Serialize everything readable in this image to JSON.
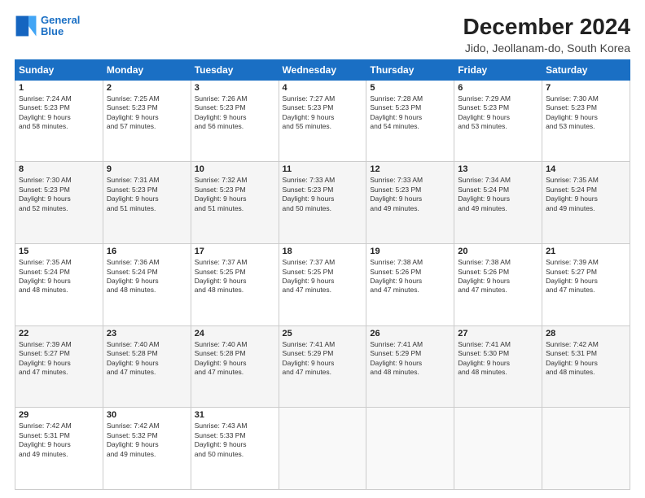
{
  "logo": {
    "line1": "General",
    "line2": "Blue"
  },
  "title": "December 2024",
  "subtitle": "Jido, Jeollanam-do, South Korea",
  "days_of_week": [
    "Sunday",
    "Monday",
    "Tuesday",
    "Wednesday",
    "Thursday",
    "Friday",
    "Saturday"
  ],
  "weeks": [
    [
      {
        "day": "1",
        "sunrise": "7:24 AM",
        "sunset": "5:23 PM",
        "daylight": "9 hours and 58 minutes."
      },
      {
        "day": "2",
        "sunrise": "7:25 AM",
        "sunset": "5:23 PM",
        "daylight": "9 hours and 57 minutes."
      },
      {
        "day": "3",
        "sunrise": "7:26 AM",
        "sunset": "5:23 PM",
        "daylight": "9 hours and 56 minutes."
      },
      {
        "day": "4",
        "sunrise": "7:27 AM",
        "sunset": "5:23 PM",
        "daylight": "9 hours and 55 minutes."
      },
      {
        "day": "5",
        "sunrise": "7:28 AM",
        "sunset": "5:23 PM",
        "daylight": "9 hours and 54 minutes."
      },
      {
        "day": "6",
        "sunrise": "7:29 AM",
        "sunset": "5:23 PM",
        "daylight": "9 hours and 53 minutes."
      },
      {
        "day": "7",
        "sunrise": "7:30 AM",
        "sunset": "5:23 PM",
        "daylight": "9 hours and 53 minutes."
      }
    ],
    [
      {
        "day": "8",
        "sunrise": "7:30 AM",
        "sunset": "5:23 PM",
        "daylight": "9 hours and 52 minutes."
      },
      {
        "day": "9",
        "sunrise": "7:31 AM",
        "sunset": "5:23 PM",
        "daylight": "9 hours and 51 minutes."
      },
      {
        "day": "10",
        "sunrise": "7:32 AM",
        "sunset": "5:23 PM",
        "daylight": "9 hours and 51 minutes."
      },
      {
        "day": "11",
        "sunrise": "7:33 AM",
        "sunset": "5:23 PM",
        "daylight": "9 hours and 50 minutes."
      },
      {
        "day": "12",
        "sunrise": "7:33 AM",
        "sunset": "5:23 PM",
        "daylight": "9 hours and 49 minutes."
      },
      {
        "day": "13",
        "sunrise": "7:34 AM",
        "sunset": "5:24 PM",
        "daylight": "9 hours and 49 minutes."
      },
      {
        "day": "14",
        "sunrise": "7:35 AM",
        "sunset": "5:24 PM",
        "daylight": "9 hours and 49 minutes."
      }
    ],
    [
      {
        "day": "15",
        "sunrise": "7:35 AM",
        "sunset": "5:24 PM",
        "daylight": "9 hours and 48 minutes."
      },
      {
        "day": "16",
        "sunrise": "7:36 AM",
        "sunset": "5:24 PM",
        "daylight": "9 hours and 48 minutes."
      },
      {
        "day": "17",
        "sunrise": "7:37 AM",
        "sunset": "5:25 PM",
        "daylight": "9 hours and 48 minutes."
      },
      {
        "day": "18",
        "sunrise": "7:37 AM",
        "sunset": "5:25 PM",
        "daylight": "9 hours and 47 minutes."
      },
      {
        "day": "19",
        "sunrise": "7:38 AM",
        "sunset": "5:26 PM",
        "daylight": "9 hours and 47 minutes."
      },
      {
        "day": "20",
        "sunrise": "7:38 AM",
        "sunset": "5:26 PM",
        "daylight": "9 hours and 47 minutes."
      },
      {
        "day": "21",
        "sunrise": "7:39 AM",
        "sunset": "5:27 PM",
        "daylight": "9 hours and 47 minutes."
      }
    ],
    [
      {
        "day": "22",
        "sunrise": "7:39 AM",
        "sunset": "5:27 PM",
        "daylight": "9 hours and 47 minutes."
      },
      {
        "day": "23",
        "sunrise": "7:40 AM",
        "sunset": "5:28 PM",
        "daylight": "9 hours and 47 minutes."
      },
      {
        "day": "24",
        "sunrise": "7:40 AM",
        "sunset": "5:28 PM",
        "daylight": "9 hours and 47 minutes."
      },
      {
        "day": "25",
        "sunrise": "7:41 AM",
        "sunset": "5:29 PM",
        "daylight": "9 hours and 47 minutes."
      },
      {
        "day": "26",
        "sunrise": "7:41 AM",
        "sunset": "5:29 PM",
        "daylight": "9 hours and 48 minutes."
      },
      {
        "day": "27",
        "sunrise": "7:41 AM",
        "sunset": "5:30 PM",
        "daylight": "9 hours and 48 minutes."
      },
      {
        "day": "28",
        "sunrise": "7:42 AM",
        "sunset": "5:31 PM",
        "daylight": "9 hours and 48 minutes."
      }
    ],
    [
      {
        "day": "29",
        "sunrise": "7:42 AM",
        "sunset": "5:31 PM",
        "daylight": "9 hours and 49 minutes."
      },
      {
        "day": "30",
        "sunrise": "7:42 AM",
        "sunset": "5:32 PM",
        "daylight": "9 hours and 49 minutes."
      },
      {
        "day": "31",
        "sunrise": "7:43 AM",
        "sunset": "5:33 PM",
        "daylight": "9 hours and 50 minutes."
      },
      null,
      null,
      null,
      null
    ]
  ]
}
